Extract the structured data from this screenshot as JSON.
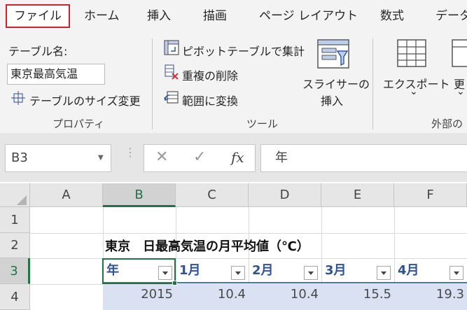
{
  "ribbon": {
    "tabs": [
      "ファイル",
      "ホーム",
      "挿入",
      "描画",
      "ページ レイアウト",
      "数式",
      "データ"
    ],
    "properties": {
      "table_name_label": "テーブル名:",
      "table_name_value": "東京最高気温",
      "resize_label": "テーブルのサイズ変更",
      "group_title": "プロパティ"
    },
    "tools": {
      "pivot_label": "ピボットテーブルで集計",
      "remove_dup_label": "重複の削除",
      "convert_range_label": "範囲に変換",
      "slicer_label_1": "スライサーの",
      "slicer_label_2": "挿入",
      "group_title": "ツール"
    },
    "external": {
      "export_label": "エクスポート",
      "export_chevron": "⌄",
      "refresh_label": "更",
      "refresh_chevron": "⌄",
      "group_title": "外部の"
    }
  },
  "formula_bar": {
    "name_box": "B3",
    "cancel": "✕",
    "enter": "✓",
    "fx": "fx",
    "content": "年"
  },
  "grid": {
    "columns": [
      "A",
      "B",
      "C",
      "D",
      "E",
      "F"
    ],
    "rows": [
      "1",
      "2",
      "3",
      "4"
    ],
    "selected_cell": "B3",
    "title": "東京　日最高気温の月平均値（℃）",
    "headers": [
      "年",
      "1月",
      "2月",
      "3月",
      "4月"
    ],
    "row4": [
      "2015",
      "10.4",
      "10.4",
      "15.5",
      "19.3"
    ]
  },
  "colors": {
    "selection": "#217346",
    "table_header": "#2f5496",
    "table_band": "#d9e1f2",
    "file_tab_outline": "#d2202f"
  }
}
